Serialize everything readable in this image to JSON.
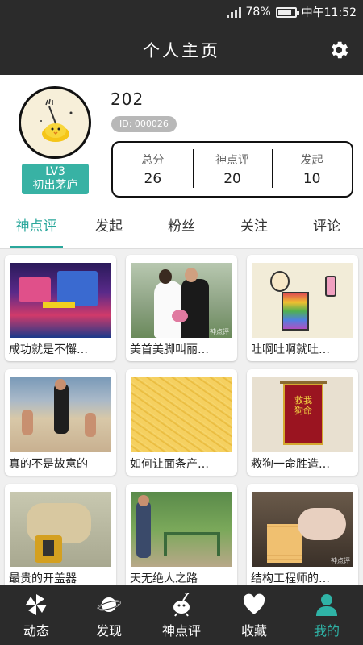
{
  "status_bar": {
    "signal": "signal-icon",
    "battery_percent": "78%",
    "time": "中午11:52"
  },
  "header": {
    "title": "个人主页",
    "settings_icon": "gear-icon"
  },
  "profile": {
    "username": "202",
    "id_label": "ID: 000026",
    "level": "LV3",
    "level_name": "初出茅庐",
    "stats": [
      {
        "label": "总分",
        "value": "26"
      },
      {
        "label": "神点评",
        "value": "20"
      },
      {
        "label": "发起",
        "value": "10"
      }
    ]
  },
  "tabs": [
    {
      "label": "神点评",
      "active": true
    },
    {
      "label": "发起",
      "active": false
    },
    {
      "label": "粉丝",
      "active": false
    },
    {
      "label": "关注",
      "active": false
    },
    {
      "label": "评论",
      "active": false
    }
  ],
  "cards": [
    {
      "caption": "成功就是不懈…",
      "watermark": ""
    },
    {
      "caption": "美首美脚叫丽…",
      "watermark": "神点评"
    },
    {
      "caption": "吐啊吐啊就吐…",
      "watermark": ""
    },
    {
      "caption": "真的不是故意的",
      "watermark": ""
    },
    {
      "caption": "如何让面条产…",
      "watermark": ""
    },
    {
      "caption": "救狗一命胜造…",
      "watermark": ""
    },
    {
      "caption": "最贵的开盖器",
      "watermark": ""
    },
    {
      "caption": "天无绝人之路",
      "watermark": ""
    },
    {
      "caption": "结构工程师的…",
      "watermark": "神点评"
    }
  ],
  "nav": [
    {
      "label": "动态",
      "icon": "pinwheel-icon",
      "active": false
    },
    {
      "label": "发现",
      "icon": "planet-icon",
      "active": false
    },
    {
      "label": "神点评",
      "icon": "bird-icon",
      "active": false
    },
    {
      "label": "收藏",
      "icon": "heart-icon",
      "active": false
    },
    {
      "label": "我的",
      "icon": "person-icon",
      "active": true
    }
  ],
  "colors": {
    "accent": "#2aa79b",
    "bar": "#2b2b2b",
    "level_badge": "#38b2a4"
  }
}
